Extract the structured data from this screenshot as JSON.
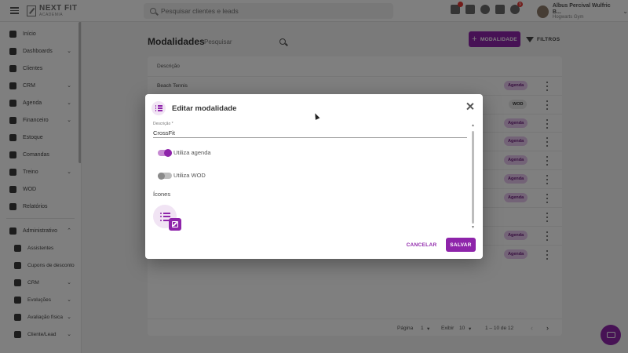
{
  "topbar": {
    "logo_title": "NEXT FIT",
    "logo_subtitle": "ACADEMIA",
    "search_placeholder": "Pesquisar clientes e leads",
    "notification_count": "9",
    "user_name": "Albus Percival Wulfric B...",
    "user_org": "Hogwarts Gym"
  },
  "sidebar": {
    "items": [
      {
        "label": "Início",
        "icon": "home-icon"
      },
      {
        "label": "Dashboards",
        "icon": "chart-icon",
        "caret": "⌄"
      },
      {
        "label": "Clientes",
        "icon": "people-icon"
      },
      {
        "label": "CRM",
        "icon": "funnel-icon",
        "caret": "⌄"
      },
      {
        "label": "Agenda",
        "icon": "calendar-icon",
        "caret": "⌄"
      },
      {
        "label": "Financeiro",
        "icon": "money-icon",
        "caret": "⌄"
      },
      {
        "label": "Estoque",
        "icon": "cart-icon"
      },
      {
        "label": "Comandas",
        "icon": "receipt-icon"
      },
      {
        "label": "Treino",
        "icon": "dumbbell-icon",
        "caret": "⌄"
      },
      {
        "label": "WOD",
        "icon": "kettlebell-icon"
      },
      {
        "label": "Relatórios",
        "icon": "report-icon"
      }
    ],
    "admin": {
      "label": "Administrativo",
      "icon": "admin-icon",
      "caret": "⌃"
    },
    "sub_items": [
      {
        "label": "Assistentes",
        "icon": "gear-icon"
      },
      {
        "label": "Cupons de desconto",
        "icon": "tag-icon"
      },
      {
        "label": "CRM",
        "icon": "funnel-icon",
        "caret": "⌄"
      },
      {
        "label": "Evoluções",
        "icon": "clipboard-icon",
        "caret": "⌄"
      },
      {
        "label": "Avaliação física",
        "icon": "scale-icon",
        "caret": "⌄"
      },
      {
        "label": "Cliente/Lead",
        "icon": "people-icon",
        "caret": "⌄"
      }
    ]
  },
  "main": {
    "title": "Modalidades",
    "search_placeholder": "Pesquisar",
    "add_label": "MODALIDADE",
    "filter_label": "FILTROS",
    "table_header": "Descrição",
    "rows": [
      {
        "name": "Beach Tennis",
        "tag": "Agenda",
        "tag_type": "agenda"
      },
      {
        "name": "",
        "tag": "WOD",
        "tag_type": "wod"
      },
      {
        "name": "",
        "tag": "Agenda",
        "tag_type": "agenda"
      },
      {
        "name": "",
        "tag": "Agenda",
        "tag_type": "agenda"
      },
      {
        "name": "",
        "tag": "Agenda",
        "tag_type": "agenda"
      },
      {
        "name": "",
        "tag": "Agenda",
        "tag_type": "agenda"
      },
      {
        "name": "",
        "tag": "Agenda",
        "tag_type": "agenda"
      },
      {
        "name": "",
        "tag": "",
        "tag_type": "none"
      },
      {
        "name": "",
        "tag": "Agenda",
        "tag_type": "agenda"
      },
      {
        "name": "",
        "tag": "Agenda",
        "tag_type": "agenda"
      }
    ],
    "pagination": {
      "page_label": "Página",
      "page_value": "1",
      "per_page_label": "Exibir",
      "per_page_value": "10",
      "range": "1 – 10 de 12"
    }
  },
  "modal": {
    "title": "Editar modalidade",
    "field_label": "Descrição *",
    "field_value": "CrossFit",
    "toggle_agenda_label": "Utiliza agenda",
    "toggle_agenda_on": true,
    "toggle_wod_label": "Utiliza WOD",
    "toggle_wod_on": false,
    "icons_label": "Ícones",
    "cancel_label": "CANCELAR",
    "save_label": "SALVAR"
  },
  "colors": {
    "accent": "#8e24aa",
    "accent_light": "#f1e4f4",
    "tag_agenda_bg": "#e7c6ee"
  }
}
